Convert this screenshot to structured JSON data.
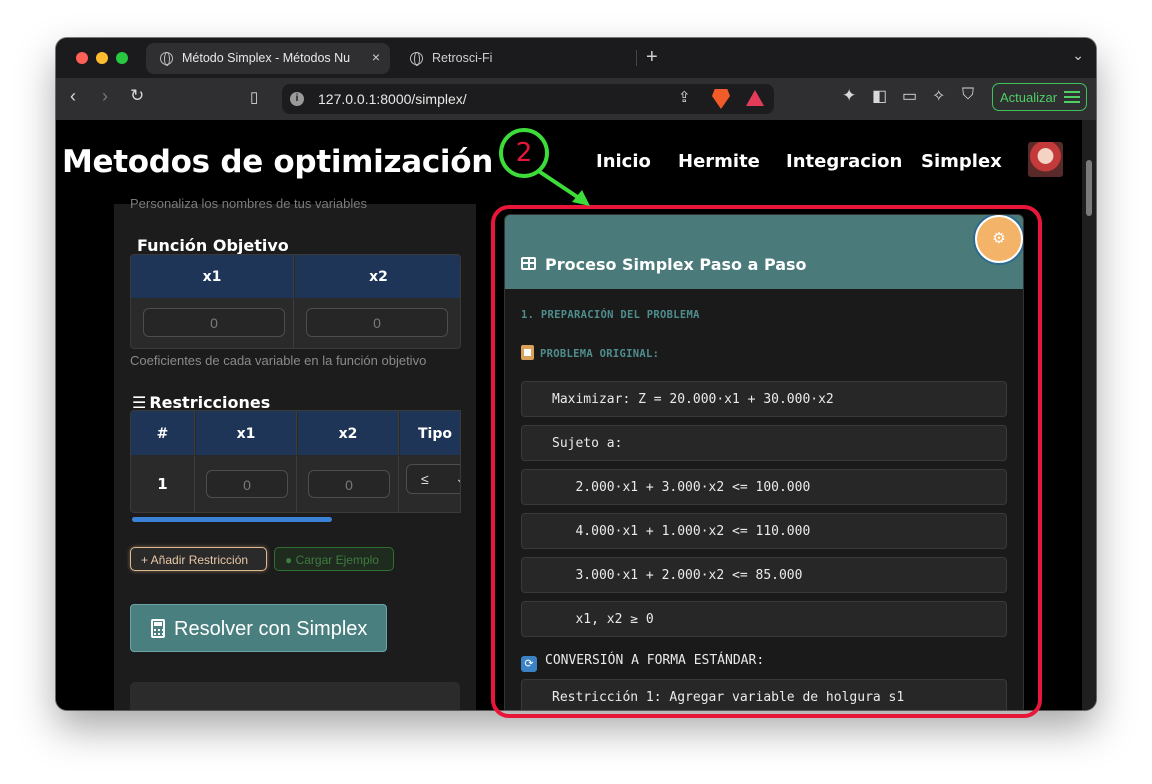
{
  "browser": {
    "tabs": [
      {
        "title": "Método Simplex - Métodos Nu",
        "close": "×"
      },
      {
        "title": "Retrosci-Fi"
      }
    ],
    "new_tab": "+",
    "tab_menu": "⌄",
    "url": "127.0.0.1:8000/simplex/",
    "update_label": "Actualizar"
  },
  "site": {
    "brand": "Metodos de optimización",
    "nav": [
      "Inicio",
      "Hermite",
      "Integracion",
      "Simplex"
    ]
  },
  "left": {
    "top_hint": "Personaliza los nombres de tus variables",
    "objective_title": "Función Objetivo",
    "objective_headers": [
      "x1",
      "x2"
    ],
    "objective_values": [
      "0",
      "0"
    ],
    "objective_caption": "Coeficientes de cada variable en la función objetivo",
    "restrictions_title": "Restricciones",
    "restrictions_headers": [
      "#",
      "x1",
      "x2",
      "Tipo"
    ],
    "restriction_row": {
      "index": "1",
      "x1": "0",
      "x2": "0",
      "tipo": "≤"
    },
    "add_button": "+ Añadir Restricción",
    "load_button": "Cargar Ejemplo",
    "solve_button": "Resolver con Simplex"
  },
  "right": {
    "card_title": "Proceso Simplex Paso a Paso",
    "step1": "1. PREPARACIÓN DEL PROBLEMA",
    "original_label": "PROBLEMA ORIGINAL:",
    "lines": [
      "Maximizar: Z = 20.000·x1 + 30.000·x2",
      "Sujeto a:",
      "   2.000·x1 + 3.000·x2 <= 100.000",
      "   4.000·x1 + 1.000·x2 <= 110.000",
      "   3.000·x1 + 2.000·x2 <= 85.000",
      "   x1, x2 ≥ 0"
    ],
    "conversion_label": "CONVERSIÓN A FORMA ESTÁNDAR:",
    "conversion_line": "Restricción 1: Agregar variable de holgura s1"
  },
  "annotation": {
    "number": "2"
  },
  "colors": {
    "accent_teal": "#4a7a7a",
    "header_navy": "#1e3557",
    "annotation_red": "#e8173a",
    "annotation_green": "#3ddc3a"
  }
}
